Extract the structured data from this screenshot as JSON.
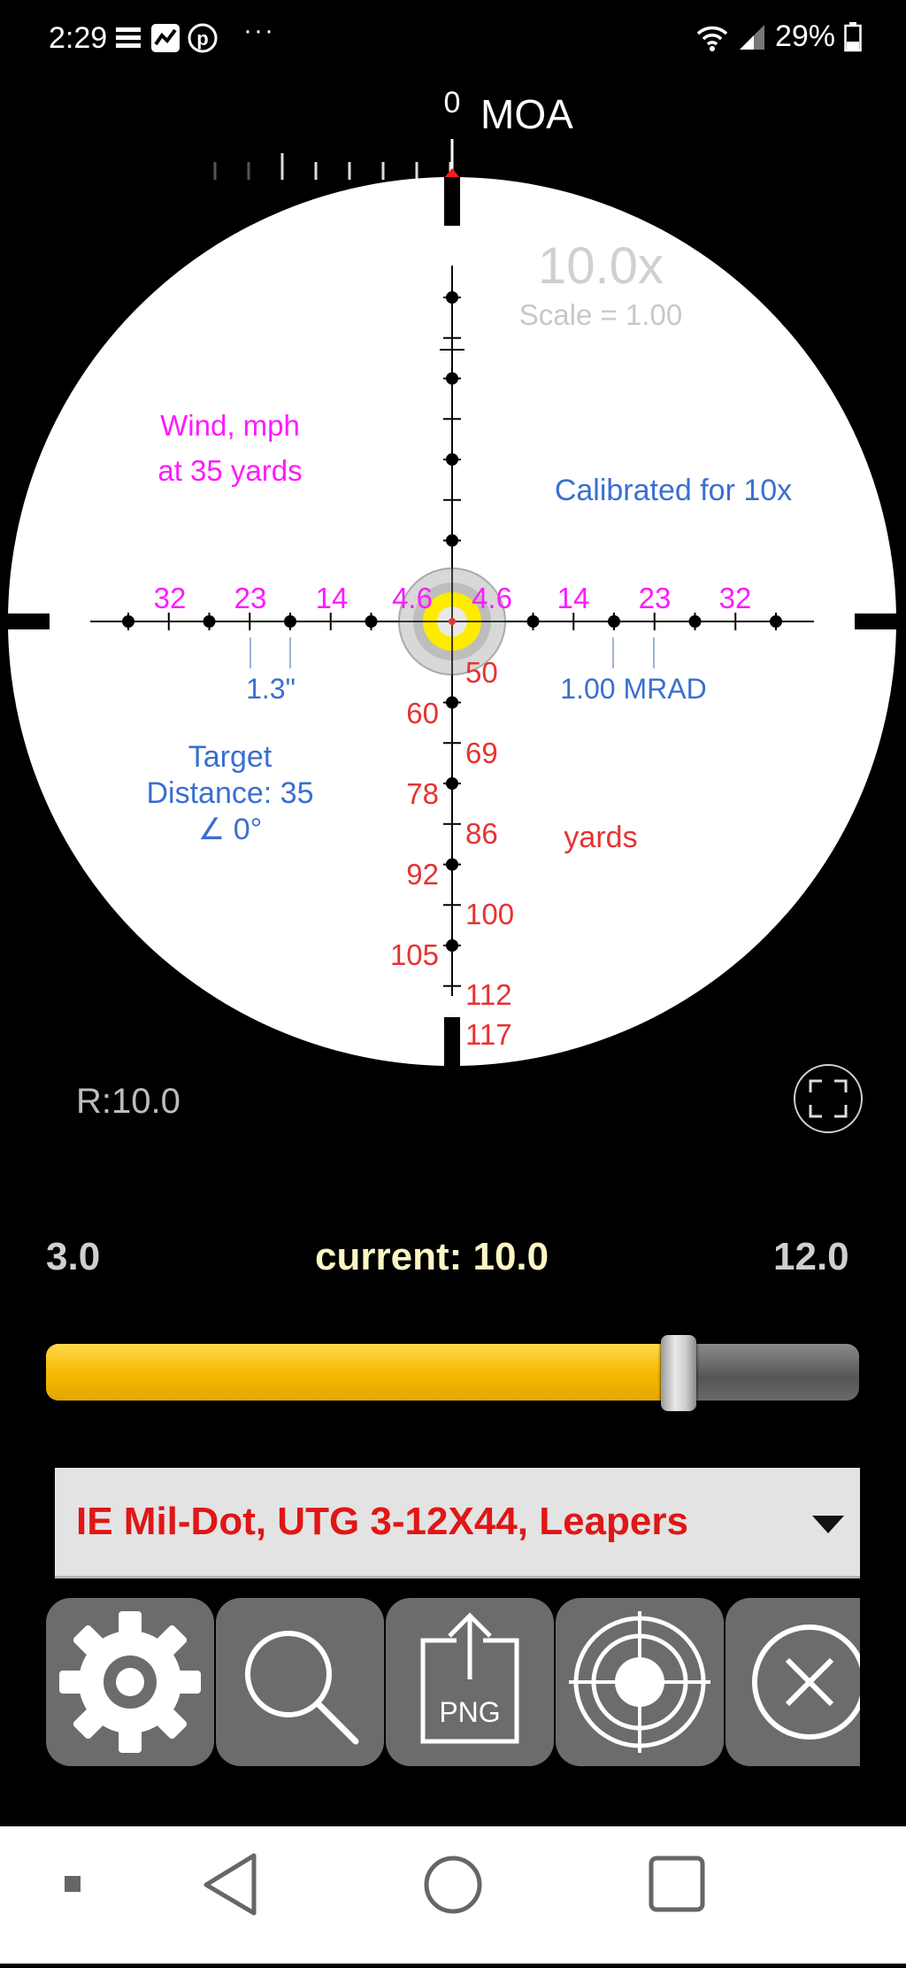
{
  "status": {
    "time": "2:29",
    "more": "···",
    "battery": "29%"
  },
  "scope": {
    "unit": "MOA",
    "top_tick_label": "0",
    "magnification": "10.0x",
    "scale": "Scale = 1.00",
    "wind_line1": "Wind, mph",
    "wind_line2": "at 35 yards",
    "calibrated": "Calibrated for 10x",
    "wind_values": [
      "32",
      "23",
      "14",
      "4.6",
      "4.6",
      "14",
      "23",
      "32"
    ],
    "group_size": "1.3\"",
    "mrad": "1.00 MRAD",
    "target_line1": "Target",
    "target_line2": "Distance: 35",
    "target_line3": "∠ 0°",
    "range_left": [
      "60",
      "78",
      "92",
      "105"
    ],
    "range_right": [
      "50",
      "69",
      "86",
      "100",
      "112",
      "117"
    ],
    "yards": "yards"
  },
  "zoom": {
    "r_value": "R:10.0",
    "min": "3.0",
    "current": "current: 10.0",
    "max": "12.0",
    "fraction": 0.7778
  },
  "reticle_select": {
    "selected": "IE Mil-Dot, UTG 3-12X44, Leapers"
  },
  "toolbar": {
    "png_label": "PNG"
  },
  "colors": {
    "magenta": "#ff1aff",
    "blue": "#3a6fd0",
    "red": "#e53333",
    "yellow": "#ffeb00"
  }
}
